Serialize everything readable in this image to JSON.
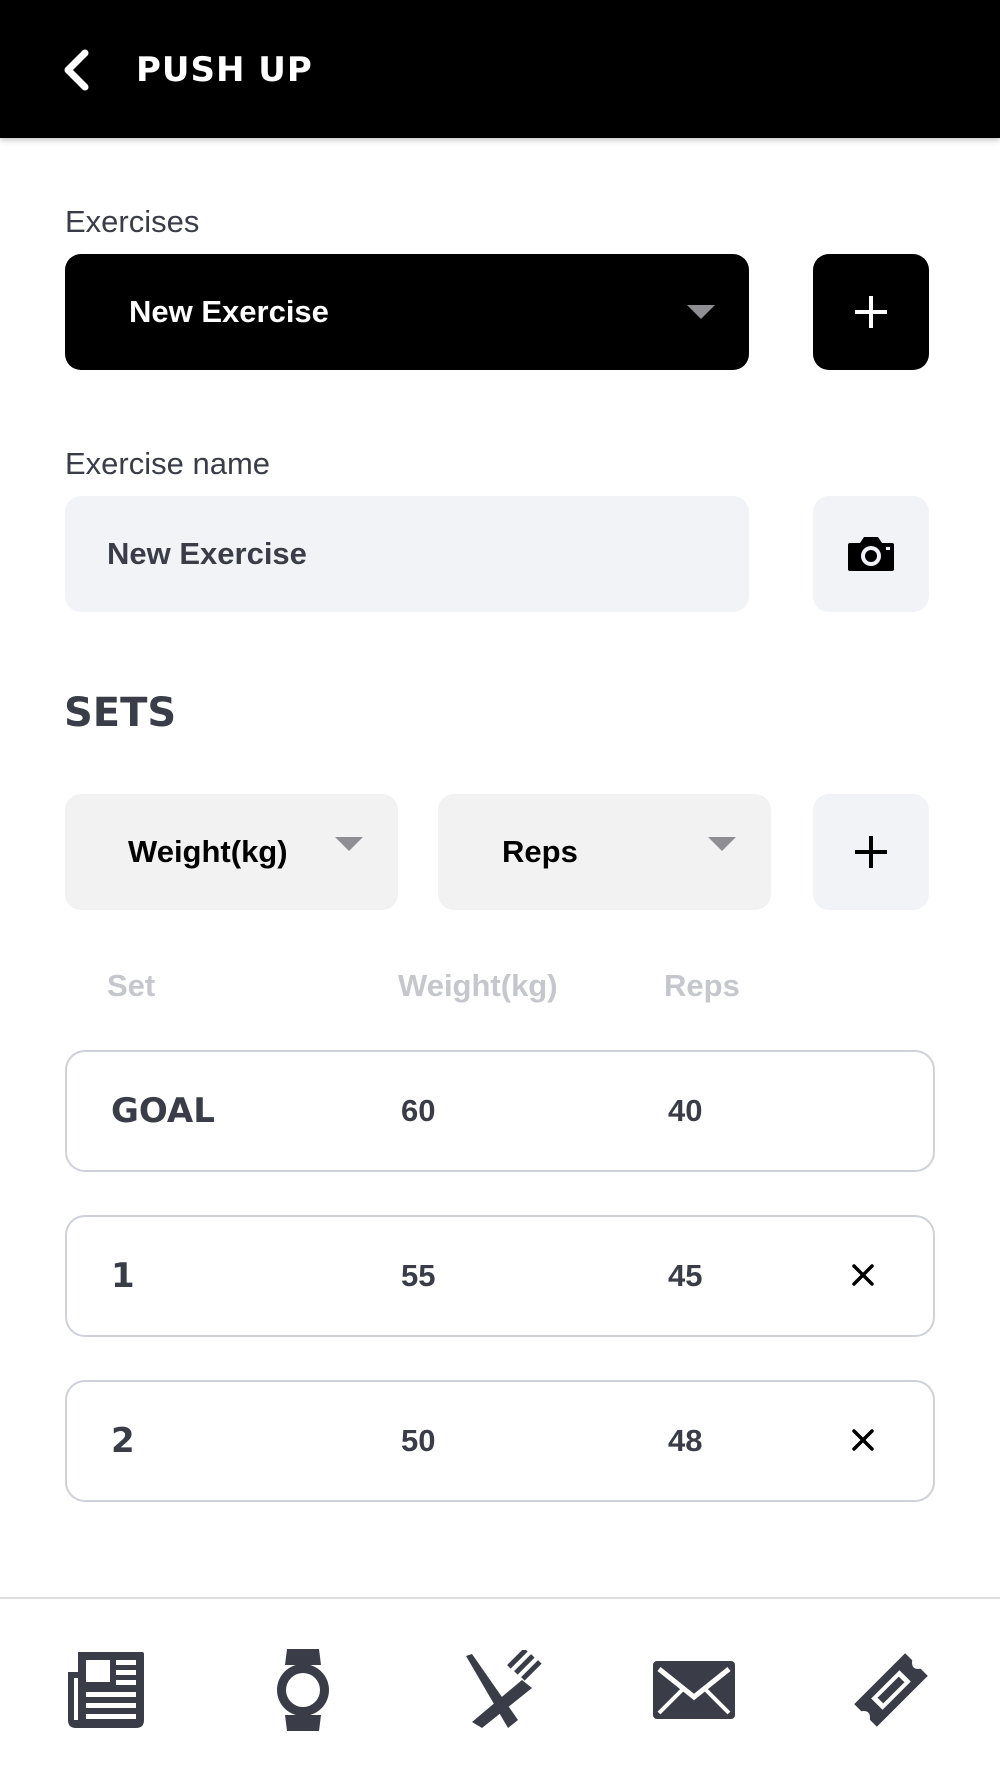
{
  "header": {
    "title": "PUSH UP",
    "back_icon": "chevron-left-icon"
  },
  "exercises": {
    "label": "Exercises",
    "selected": "New Exercise",
    "add_icon": "plus-icon"
  },
  "exercise_name": {
    "label": "Exercise name",
    "value": "New Exercise",
    "camera_icon": "camera-icon"
  },
  "sets": {
    "title": "SETS",
    "metric_1": "Weight(kg)",
    "metric_2": "Reps",
    "add_icon": "plus-icon",
    "columns": {
      "set": "Set",
      "weight": "Weight(kg)",
      "reps": "Reps"
    },
    "rows": [
      {
        "set": "GOAL",
        "weight": "60",
        "reps": "40",
        "removable": false
      },
      {
        "set": "1",
        "weight": "55",
        "reps": "45",
        "removable": true
      },
      {
        "set": "2",
        "weight": "50",
        "reps": "48",
        "removable": true
      }
    ]
  },
  "bottom_nav": {
    "items": [
      {
        "icon": "newspaper-icon"
      },
      {
        "icon": "watch-icon"
      },
      {
        "icon": "fork-knife-icon"
      },
      {
        "icon": "envelope-icon"
      },
      {
        "icon": "ticket-icon"
      }
    ]
  },
  "colors": {
    "header_bg": "#000000",
    "text_dark": "#3a3d47",
    "field_bg": "#f2f3f7",
    "muted": "#c5c7cd",
    "border": "#cfd1d8"
  }
}
